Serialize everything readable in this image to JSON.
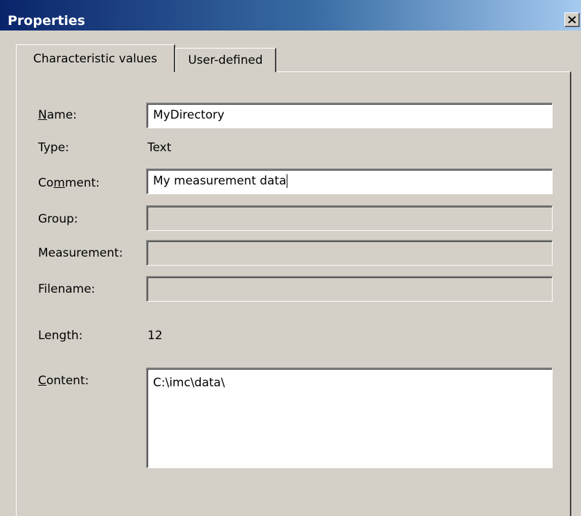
{
  "window": {
    "title": "Properties",
    "close_glyph": "✕"
  },
  "tabs": [
    {
      "label": "Characteristic values",
      "active": true
    },
    {
      "label": "User-defined",
      "active": false
    }
  ],
  "fields": {
    "name": {
      "label_ul": "N",
      "label_rest": "ame:",
      "value": "MyDirectory"
    },
    "type": {
      "label": "Type:",
      "value": "Text"
    },
    "comment": {
      "label_pre": "Co",
      "label_ul": "m",
      "label_rest": "ment:",
      "value": "My measurement data"
    },
    "group": {
      "label": "Group:",
      "value": ""
    },
    "measurement": {
      "label": "Measurement:",
      "value": ""
    },
    "filename": {
      "label": "Filename:",
      "value": ""
    },
    "length": {
      "label": "Length:",
      "value": "12"
    },
    "content": {
      "label_ul": "C",
      "label_rest": "ontent:",
      "value": "C:\\imc\\data\\"
    }
  },
  "colors": {
    "face": "#d4d0c8",
    "title_start": "#0a246a",
    "title_end": "#a6caf0"
  }
}
